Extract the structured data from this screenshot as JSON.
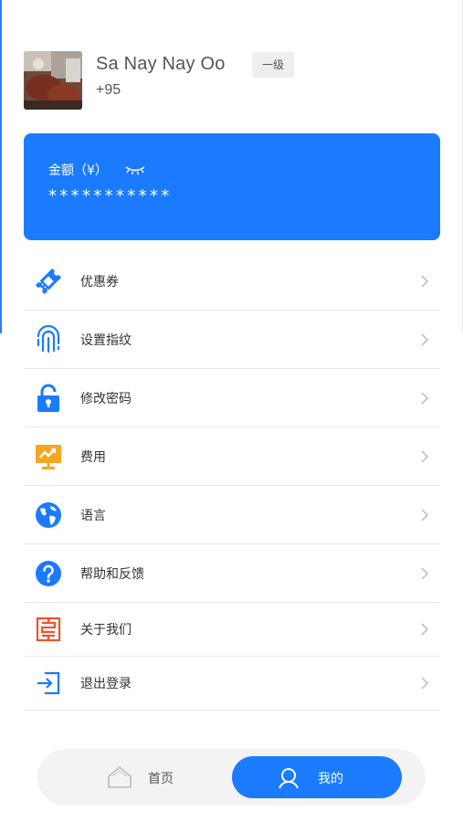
{
  "profile": {
    "name": "Sa Nay Nay Oo",
    "phone": "+95",
    "level": "一级"
  },
  "balance": {
    "label": "金额（¥）",
    "value": "***********"
  },
  "menu": {
    "items": [
      {
        "label": "优惠券",
        "icon": "coupon-icon",
        "color": "#1a7bff"
      },
      {
        "label": "设置指纹",
        "icon": "fingerprint-icon",
        "color": "#1a7bff"
      },
      {
        "label": "修改密码",
        "icon": "unlock-icon",
        "color": "#1a7bff"
      },
      {
        "label": "费用",
        "icon": "chart-board-icon",
        "color": "#f5a623"
      },
      {
        "label": "语言",
        "icon": "globe-icon",
        "color": "#1a7bff"
      },
      {
        "label": "帮助和反馈",
        "icon": "help-icon",
        "color": "#1a7bff"
      },
      {
        "label": "关于我们",
        "icon": "about-pattern-icon",
        "color": "#f0522b"
      },
      {
        "label": "退出登录",
        "icon": "logout-icon",
        "color": "#1a7bff"
      }
    ]
  },
  "tabbar": {
    "home_label": "首页",
    "mine_label": "我的",
    "active": "mine"
  },
  "colors": {
    "primary": "#1a7bff",
    "orange": "#f5a623",
    "red": "#f0522b"
  }
}
